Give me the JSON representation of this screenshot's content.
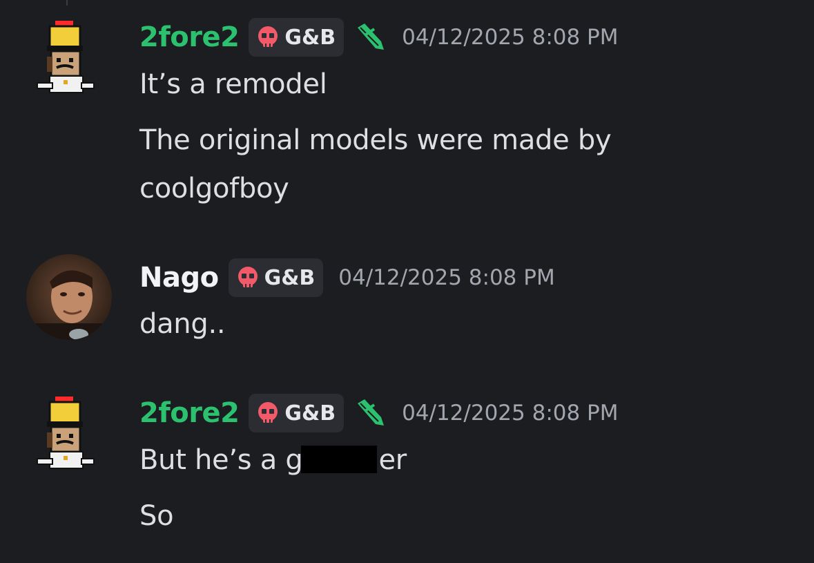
{
  "colors": {
    "background": "#1c1d21",
    "username_green": "#2bc16e",
    "username_white": "#f2f3f5",
    "message_text": "#dddfe3",
    "timestamp": "#a3a6ae",
    "tag_background": "#2b2d33",
    "skull_red": "#f25a6a",
    "role_icon_green": "#2bc16e"
  },
  "messages": [
    {
      "username": "2fore2",
      "avatar_icon": "hussar-soldier-avatar",
      "tag": {
        "icon": "skull-icon",
        "text": "G&B"
      },
      "role_icon": "trumpet-icon",
      "timestamp": "04/12/2025 8:08 PM",
      "lines": [
        "It’s a remodel",
        "The original models were made by",
        "coolgofboy"
      ]
    },
    {
      "username": "Nago",
      "avatar_icon": "photo-avatar",
      "tag": {
        "icon": "skull-icon",
        "text": "G&B"
      },
      "timestamp": "04/12/2025 8:08 PM",
      "lines": [
        "dang.."
      ]
    },
    {
      "username": "2fore2",
      "avatar_icon": "hussar-soldier-avatar",
      "tag": {
        "icon": "skull-icon",
        "text": "G&B"
      },
      "role_icon": "trumpet-icon",
      "timestamp": "04/12/2025 8:08 PM",
      "lines": [
        {
          "before": "But he’s a g",
          "redacted": true,
          "after": "er"
        },
        "So"
      ]
    }
  ]
}
